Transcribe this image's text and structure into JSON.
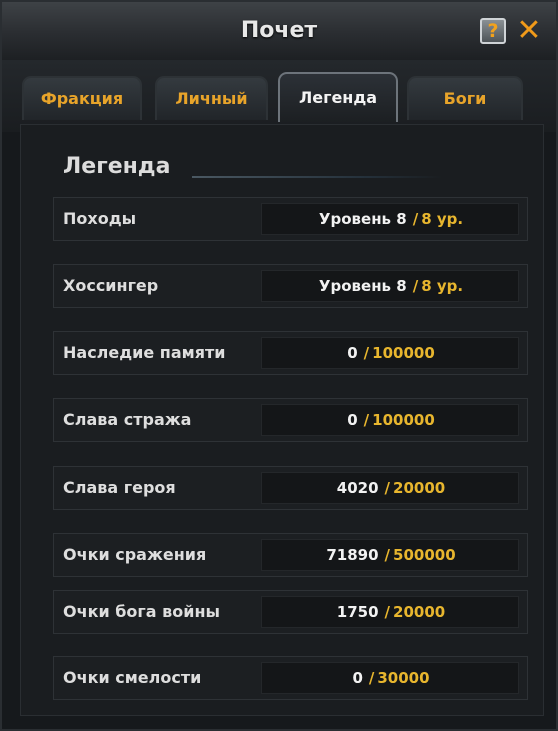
{
  "window": {
    "title": "Почет",
    "help_glyph": "?",
    "close_glyph": "✕"
  },
  "tabs": [
    {
      "label": "Фракция",
      "active": false
    },
    {
      "label": "Личный",
      "active": false
    },
    {
      "label": "Легенда",
      "active": true
    },
    {
      "label": "Боги",
      "active": false
    }
  ],
  "section": {
    "title": "Легенда"
  },
  "rows": [
    {
      "label": "Походы",
      "current": "Уровень 8",
      "max": "8 ур."
    },
    {
      "label": "Хоссингер",
      "current": "Уровень 8",
      "max": "8 ур."
    },
    {
      "label": "Наследие памяти",
      "current": "0",
      "max": "100000"
    },
    {
      "label": "Слава стража",
      "current": "0",
      "max": "100000"
    },
    {
      "label": "Слава героя",
      "current": "4020",
      "max": "20000"
    },
    {
      "label": "Очки сражения",
      "current": "71890",
      "max": "500000"
    },
    {
      "label": "Очки бога войны",
      "current": "1750",
      "max": "20000"
    },
    {
      "label": "Очки смелости",
      "current": "0",
      "max": "30000"
    }
  ],
  "separator": "/",
  "colors": {
    "accent": "#e8b62e",
    "tab_text": "#e8a42a",
    "close": "#f09a1a"
  },
  "icons": [
    "help-icon",
    "close-icon"
  ]
}
